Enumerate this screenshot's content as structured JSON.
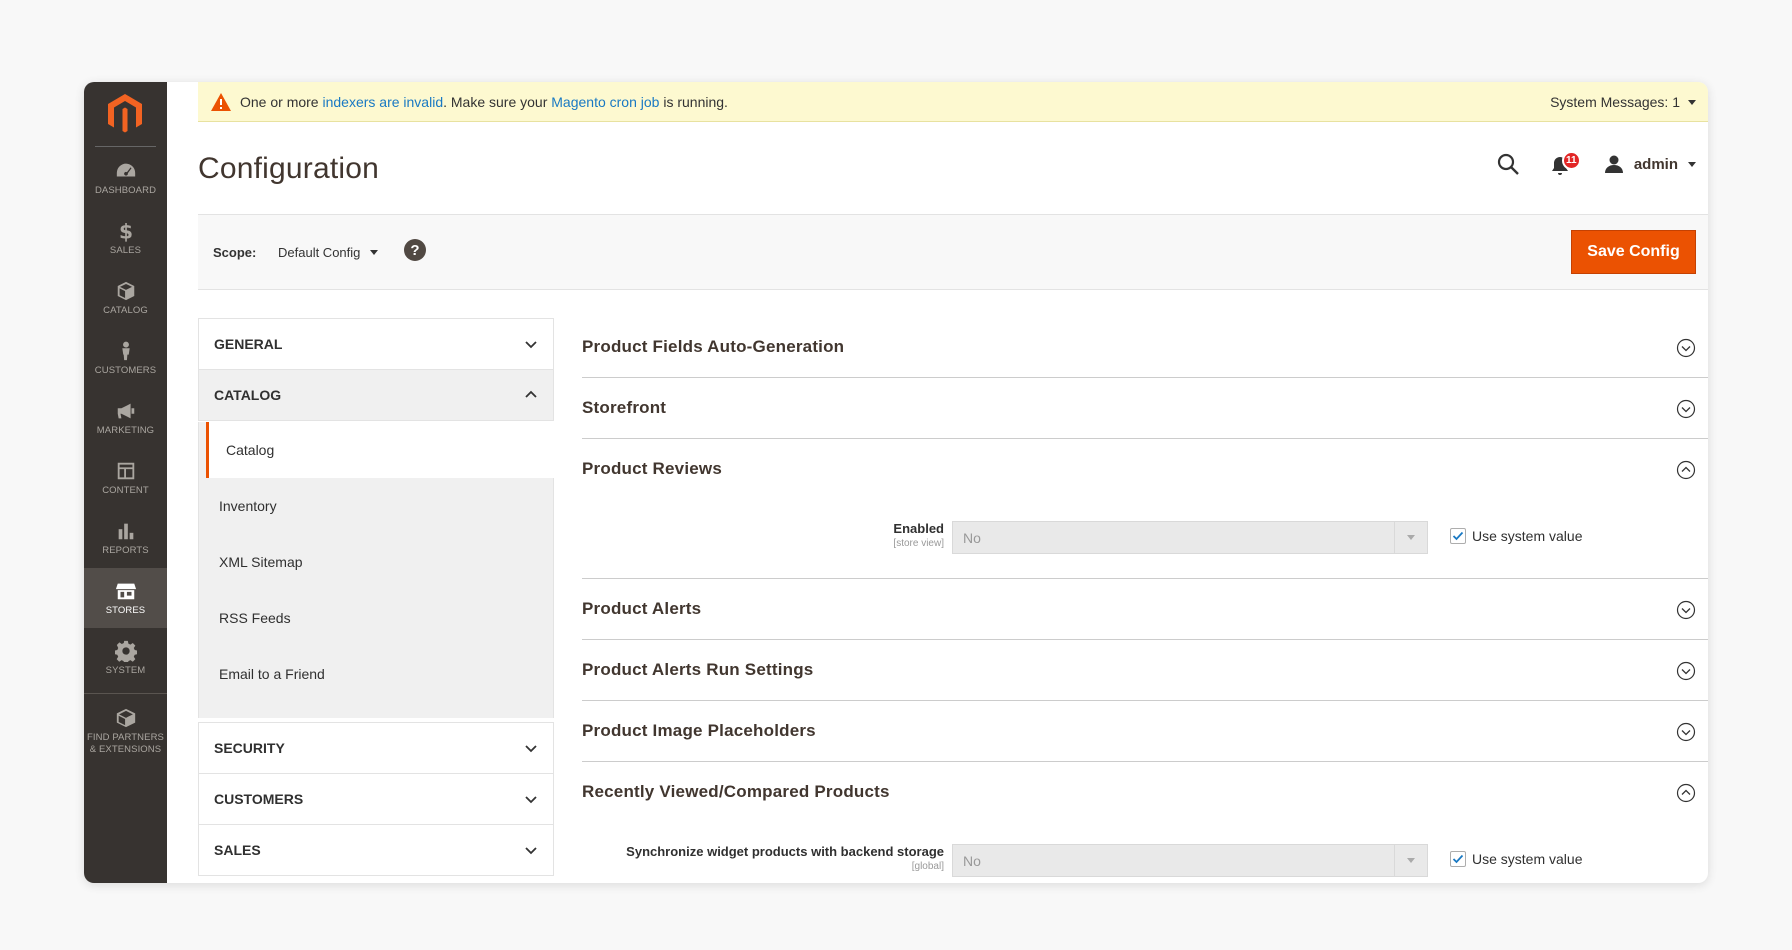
{
  "menu": {
    "items": [
      {
        "label": "DASHBOARD",
        "icon": "dashboard-icon"
      },
      {
        "label": "SALES",
        "icon": "dollar-icon"
      },
      {
        "label": "CATALOG",
        "icon": "cube-icon"
      },
      {
        "label": "CUSTOMERS",
        "icon": "person-icon"
      },
      {
        "label": "MARKETING",
        "icon": "megaphone-icon"
      },
      {
        "label": "CONTENT",
        "icon": "layout-icon"
      },
      {
        "label": "REPORTS",
        "icon": "bar-chart-icon"
      },
      {
        "label": "STORES",
        "icon": "storefront-icon"
      },
      {
        "label": "SYSTEM",
        "icon": "gear-icon"
      },
      {
        "label_line1": "FIND PARTNERS",
        "label_line2": "& EXTENSIONS",
        "icon": "box-icon"
      }
    ],
    "active": "STORES",
    "brand_color": "#eb5202"
  },
  "system_message": {
    "prefix": "One or more ",
    "link1": "indexers are invalid",
    "middle": ". Make sure your ",
    "link2": "Magento cron job",
    "suffix": " is running.",
    "counter": "System Messages: 1"
  },
  "header": {
    "title": "Configuration",
    "notification_count": "11",
    "user": "admin"
  },
  "scope": {
    "label": "Scope:",
    "value": "Default Config",
    "help": "?",
    "save_label": "Save Config"
  },
  "nav": {
    "tabs": [
      {
        "label": "GENERAL",
        "open": false
      },
      {
        "label": "CATALOG",
        "open": true
      },
      {
        "label": "SECURITY",
        "open": false
      },
      {
        "label": "CUSTOMERS",
        "open": false
      },
      {
        "label": "SALES",
        "open": false
      }
    ],
    "catalog_items": [
      "Catalog",
      "Inventory",
      "XML Sitemap",
      "RSS Feeds",
      "Email to a Friend"
    ],
    "active_item": "Catalog"
  },
  "sections": [
    {
      "title": "Product Fields Auto-Generation",
      "expanded": false
    },
    {
      "title": "Storefront",
      "expanded": false
    },
    {
      "title": "Product Reviews",
      "expanded": true
    },
    {
      "title": "Product Alerts",
      "expanded": false
    },
    {
      "title": "Product Alerts Run Settings",
      "expanded": false
    },
    {
      "title": "Product Image Placeholders",
      "expanded": false
    },
    {
      "title": "Recently Viewed/Compared Products",
      "expanded": true
    }
  ],
  "fields": {
    "reviews_enabled": {
      "label": "Enabled",
      "scope": "[store view]",
      "value": "No",
      "use_system": "Use system value",
      "checked": true
    },
    "sync_widget": {
      "label": "Synchronize widget products with backend storage",
      "scope": "[global]",
      "value": "No",
      "use_system": "Use system value",
      "checked": true
    }
  }
}
